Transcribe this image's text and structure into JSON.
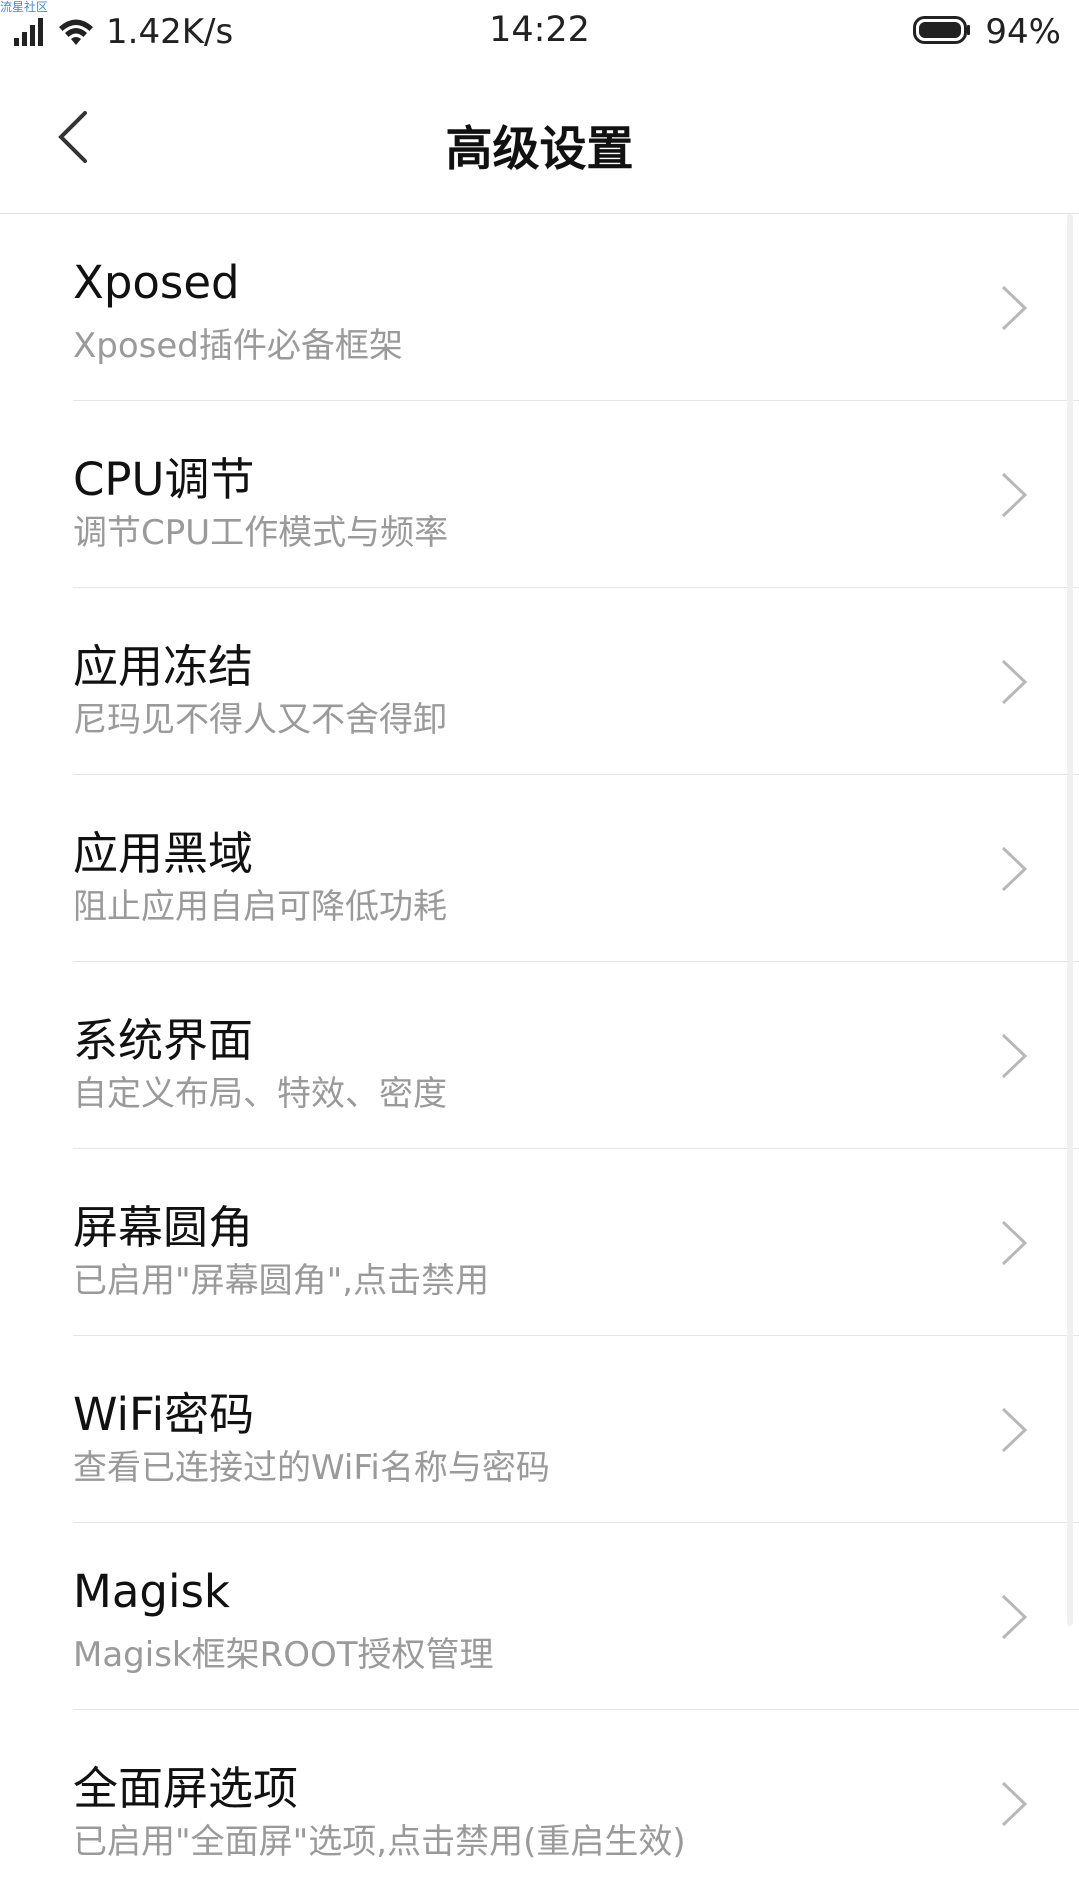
{
  "watermark": "流星社区",
  "status_bar": {
    "signal_icon": "cell-signal-icon",
    "wifi_icon": "wifi-icon",
    "net_speed": "1.42K/s",
    "time": "14:22",
    "battery_icon": "battery-icon",
    "battery_pct": "94%"
  },
  "header": {
    "back_icon": "chevron-left-icon",
    "title": "高级设置"
  },
  "items": [
    {
      "title": "Xposed",
      "subtitle": "Xposed插件必备框架"
    },
    {
      "title": "CPU调节",
      "subtitle": "调节CPU工作模式与频率"
    },
    {
      "title": "应用冻结",
      "subtitle": "尼玛见不得人又不舍得卸"
    },
    {
      "title": "应用黑域",
      "subtitle": "阻止应用自启可降低功耗"
    },
    {
      "title": "系统界面",
      "subtitle": "自定义布局、特效、密度"
    },
    {
      "title": "屏幕圆角",
      "subtitle": "已启用\"屏幕圆角\",点击禁用"
    },
    {
      "title": "WiFi密码",
      "subtitle": "查看已连接过的WiFi名称与密码"
    },
    {
      "title": "Magisk",
      "subtitle": "Magisk框架ROOT授权管理"
    },
    {
      "title": "全面屏选项",
      "subtitle": "已启用\"全面屏\"选项,点击禁用(重启生效)"
    }
  ],
  "colors": {
    "title_text": "#111111",
    "subtitle_text": "#9a9a9a",
    "divider": "#e6e6e6",
    "chevron": "#b8b8b8"
  }
}
